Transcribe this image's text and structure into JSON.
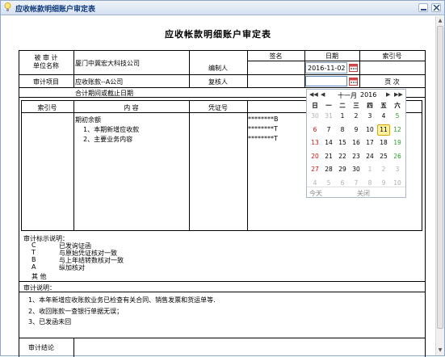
{
  "window": {
    "title": "应收帐款明细账户审定表"
  },
  "doc": {
    "title": "应收帐款明细账户审定表",
    "audited_unit_label": "被 审 计\n单位名称",
    "audited_unit_value": "厦门中冀宏大科技公司",
    "audit_item_label": "审计项目",
    "audit_item_value": "应收账款--A公司",
    "period_label": "合计期间或截止日期",
    "sign_label": "签名",
    "date_label": "日期",
    "index_label": "索引号",
    "preparer_label": "编制人",
    "preparer_date": "2016-11-02",
    "reviewer_label": "复核人",
    "page_label": "页  次",
    "table": {
      "headers": [
        "索引号",
        "内  容",
        "凭证号"
      ],
      "rows": [
        {
          "content": "期初余额",
          "code": "********B"
        },
        {
          "content": "1、本期新增应收款",
          "code": "********T"
        },
        {
          "content": "2、主要业务内容",
          "code": "********T"
        }
      ]
    },
    "legend_title": "审计标示说明：",
    "legend": [
      {
        "sym": "C",
        "text": "已发询证函"
      },
      {
        "sym": "T",
        "text": "与原始凭证核对一致"
      },
      {
        "sym": "B",
        "text": "与上年结转数核对一致"
      },
      {
        "sym": "A",
        "text": "纵加核对"
      }
    ],
    "legend_other": "其  他",
    "notes_title": "审计说明：",
    "notes": [
      "1、本年新增应收账款业务已检查有关合同、销售发票和货运单等.",
      "2、收回账款一查银行单据无误；",
      "3、已发函未回"
    ],
    "conclusion_title": "审计结论"
  },
  "calendar": {
    "prev_year": "◀◀",
    "prev_month": "◀",
    "month_label": "十一月",
    "year_label": "2016",
    "next_month": "▶",
    "next_year": "▶▶",
    "weekdays": [
      "日",
      "一",
      "二",
      "三",
      "四",
      "五",
      "六"
    ],
    "weeks": [
      [
        "30",
        "31",
        "1",
        "2",
        "3",
        "4",
        "5"
      ],
      [
        "6",
        "7",
        "8",
        "9",
        "10",
        "11",
        "12"
      ],
      [
        "13",
        "14",
        "15",
        "16",
        "17",
        "18",
        "19"
      ],
      [
        "20",
        "21",
        "22",
        "23",
        "24",
        "25",
        "26"
      ],
      [
        "27",
        "28",
        "29",
        "30",
        "1",
        "2",
        "3"
      ],
      [
        "4",
        "5",
        "6",
        "7",
        "8",
        "9",
        "10"
      ]
    ],
    "today_label": "今天",
    "close_label": "关闭",
    "selected_day": "11"
  }
}
